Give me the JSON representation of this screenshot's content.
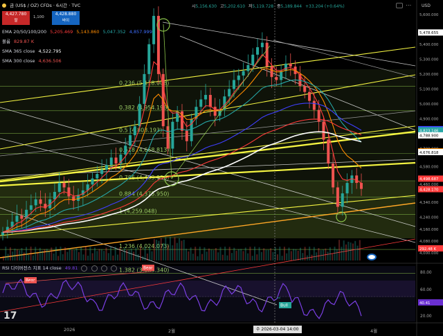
{
  "header": {
    "symbol_name": "금 (US$ / OZ) CFDs · 6시간 · TVC",
    "sell_price": "4,427.780",
    "sell_label": "팔",
    "qty": "1,100",
    "buy_price": "4,428.880",
    "buy_label": "바이",
    "ohlc": [
      {
        "label": "시",
        "value": "5,156.630"
      },
      {
        "label": "고",
        "value": "5,202.610"
      },
      {
        "label": "저",
        "value": "5,119.728"
      },
      {
        "label": "종",
        "value": "5,189.844"
      },
      {
        "label": "",
        "value": "+33.204 (+0.64%)"
      }
    ],
    "currency": "USD"
  },
  "indicators": {
    "ema_label": "EMA 20/50/100/200",
    "ema_values": [
      "5,205.469",
      "5,143.860",
      "5,047.352",
      "4,857.999"
    ],
    "volume_label": "볼륨",
    "volume_value": "829.87 K",
    "sma365_label": "SMA 365 close",
    "sma365_value": "4,522.795",
    "sma300_label": "SMA 300 close",
    "sma300_value": "4,636.506"
  },
  "rsi": {
    "label": "RSI 다이버전스 지표 14 close",
    "value": "49.81",
    "current": "40.41",
    "bear_label": "Bear",
    "bull_label": "Bull"
  },
  "fib_levels": [
    {
      "ratio": "0.236",
      "label": "0.236 (5,118.008)",
      "price": 5118.008
    },
    {
      "ratio": "0.382",
      "label": "0.382 (4,954.196)",
      "price": 4954.196
    },
    {
      "ratio": "0.5",
      "label": "0.5 (4,803.193)",
      "price": 4803.193
    },
    {
      "ratio": "0.618",
      "label": "0.618 (4,668.813)",
      "price": 4668.813
    },
    {
      "ratio": "0.786",
      "label": "0.786 (4,483.956)",
      "price": 4483.956
    },
    {
      "ratio": "0.884",
      "label": "0.884 (4,375.950)",
      "price": 4375.95
    },
    {
      "ratio": "1",
      "label": "1 (4,259.048)",
      "price": 4259.048
    },
    {
      "ratio": "1.236",
      "label": "1.236 (4,024.073)",
      "price": 4024.073
    },
    {
      "ratio": "1.382",
      "label": "1.382 (3,863.340)",
      "price": 3863.34
    }
  ],
  "axis_labels": {
    "price_ticks": [
      "5,600.000",
      "5,400.000",
      "5,300.000",
      "5,200.000",
      "5,100.000",
      "5,000.000",
      "4,900.000",
      "4,700.000",
      "4,580.000",
      "4,460.000",
      "4,340.000",
      "4,240.000",
      "4,160.000",
      "4,080.000",
      "4,000.000"
    ],
    "rsi_ticks": [
      "80.00",
      "60.00",
      "20.00"
    ],
    "time_ticks": [
      "2026",
      "2월",
      "4월"
    ],
    "crosshair_time": "수 2026-03-04  14:00"
  },
  "price_tags": [
    {
      "label": "5,478.655",
      "bg": "#ffffff",
      "fg": "#000000",
      "price": 5478.655
    },
    {
      "label": "4,830.520",
      "bg": "#3f3fff",
      "fg": "#ffffff",
      "price": 4830.52
    },
    {
      "label": "4,823.146",
      "bg": "#26a6a6",
      "fg": "#ffffff",
      "price": 4823.146
    },
    {
      "label": "4,788.900",
      "bg": "#ffffff",
      "fg": "#000000",
      "price": 4788.9
    },
    {
      "label": "4,681.501",
      "bg": "#ff8c00",
      "fg": "#000000",
      "price": 4681.501
    },
    {
      "label": "4,676.818",
      "bg": "#ffffff",
      "fg": "#000000",
      "price": 4676.818
    },
    {
      "label": "4,498.687",
      "bg": "#ff3b3b",
      "fg": "#ffffff",
      "price": 4498.687
    },
    {
      "label": "4,428.170",
      "bg": "#ff3b3b",
      "fg": "#ffffff",
      "price": 4428.17
    },
    {
      "label": "292.48 K",
      "bg": "#ff3b3b",
      "fg": "#ffffff",
      "price": 3950
    },
    {
      "label": "40.41",
      "bg": "#6a2fd0",
      "fg": "#ffffff",
      "price": 0
    }
  ],
  "colors": {
    "ema20": "#ff3b3b",
    "ema50": "#ff8c00",
    "ema100": "#26a6a6",
    "ema200": "#3f3fff",
    "sma365": "#ffffff",
    "sma300": "#ff3b3b",
    "fib": "#8bc34a",
    "channel": "#f5f542",
    "rsi": "#7b3fe4",
    "up": "#26a69a",
    "down": "#ef5350"
  },
  "chart_data": {
    "type": "candlestick",
    "symbol": "금 (US$ / OZ) CFDs",
    "timeframe": "6시간",
    "ylim": [
      3950,
      5650
    ],
    "series": [
      {
        "name": "EMA 20",
        "last": 5205.469
      },
      {
        "name": "EMA 50",
        "last": 5143.86
      },
      {
        "name": "EMA 100",
        "last": 5047.352
      },
      {
        "name": "EMA 200",
        "last": 4857.999
      },
      {
        "name": "SMA 365 close",
        "last": 4522.795
      },
      {
        "name": "SMA 300 close",
        "last": 4636.506
      }
    ],
    "close_path": [
      4140,
      4175,
      4210,
      4250,
      4230,
      4290,
      4320,
      4360,
      4330,
      4300,
      4360,
      4410,
      4470,
      4440,
      4380,
      4350,
      4390,
      4420,
      4460,
      4500,
      4530,
      4560,
      4590,
      4640,
      4600,
      4660,
      4720,
      4790,
      4850,
      5000,
      5200,
      5400,
      5590,
      5200,
      4850,
      4700,
      4880,
      4950,
      4820,
      4750,
      4900,
      4980,
      5030,
      5060,
      4980,
      4920,
      4960,
      5050,
      5100,
      5160,
      5190,
      5220,
      5260,
      5330,
      5380,
      5410,
      5250,
      5180,
      5160,
      5220,
      5270,
      5250,
      5200,
      5120,
      5080,
      5020,
      4960,
      4880,
      4760,
      4600,
      4440,
      4310,
      4400,
      4470,
      4520,
      4470,
      4430
    ]
  }
}
